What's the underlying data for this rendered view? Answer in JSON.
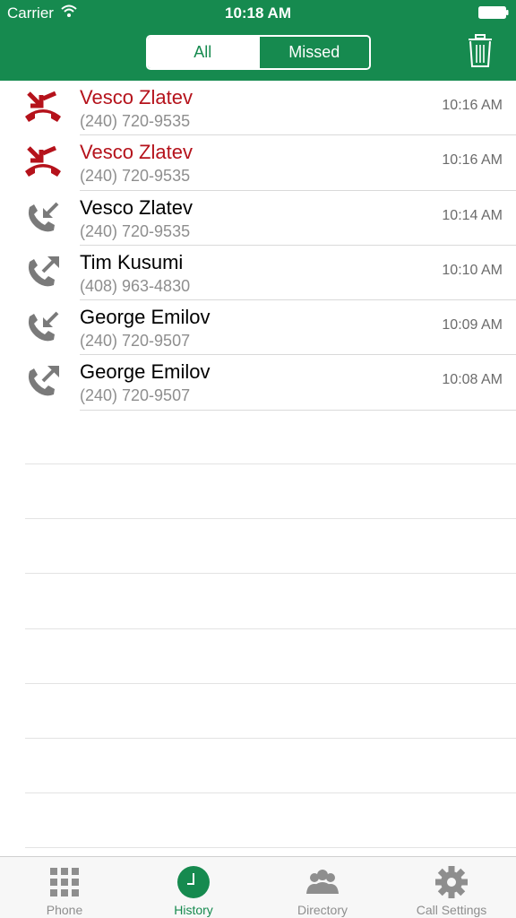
{
  "status": {
    "carrier": "Carrier",
    "time": "10:18 AM"
  },
  "segmented": {
    "all_label": "All",
    "missed_label": "Missed",
    "selected": "All"
  },
  "colors": {
    "brand": "#168a4f",
    "missed": "#b5121b",
    "icon_gray": "#7a7a7a"
  },
  "calls": [
    {
      "name": "Vesco Zlatev",
      "number": "(240) 720-9535",
      "time": "10:16 AM",
      "type": "missed",
      "icon": "missed-call-icon"
    },
    {
      "name": "Vesco Zlatev",
      "number": "(240) 720-9535",
      "time": "10:16 AM",
      "type": "missed",
      "icon": "missed-call-icon"
    },
    {
      "name": "Vesco Zlatev",
      "number": "(240) 720-9535",
      "time": "10:14 AM",
      "type": "incoming",
      "icon": "incoming-call-icon"
    },
    {
      "name": "Tim Kusumi",
      "number": "(408) 963-4830",
      "time": "10:10 AM",
      "type": "outgoing",
      "icon": "outgoing-call-icon"
    },
    {
      "name": "George Emilov",
      "number": "(240) 720-9507",
      "time": "10:09 AM",
      "type": "incoming",
      "icon": "incoming-call-icon"
    },
    {
      "name": "George Emilov",
      "number": "(240) 720-9507",
      "time": "10:08 AM",
      "type": "outgoing",
      "icon": "outgoing-call-icon"
    }
  ],
  "tabs": [
    {
      "label": "Phone",
      "icon": "keypad-icon",
      "active": false
    },
    {
      "label": "History",
      "icon": "clock-icon",
      "active": true
    },
    {
      "label": "Directory",
      "icon": "contacts-icon",
      "active": false
    },
    {
      "label": "Call Settings",
      "icon": "gear-icon",
      "active": false
    }
  ]
}
